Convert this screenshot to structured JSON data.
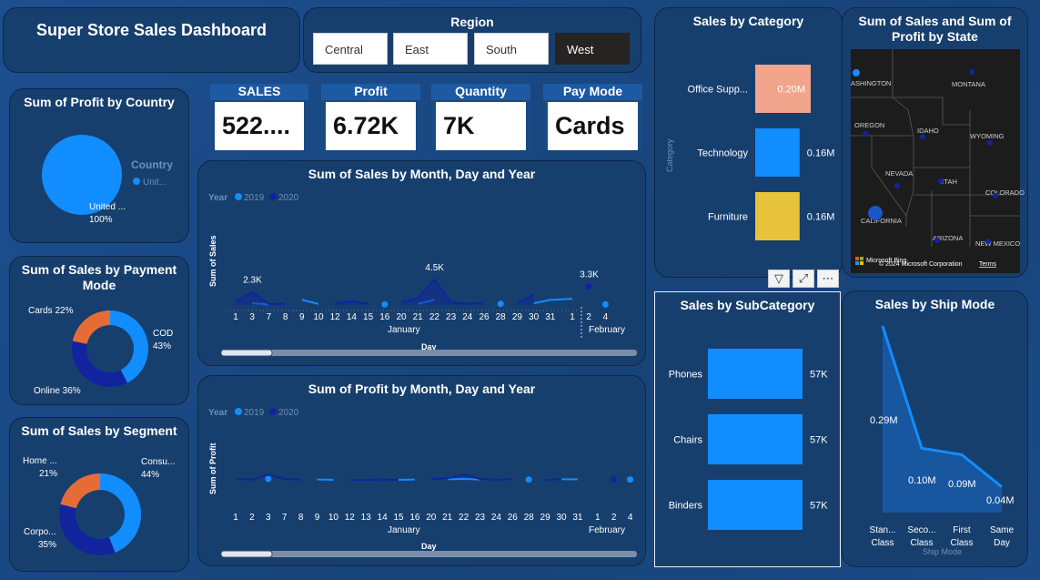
{
  "title": "Super Store Sales Dashboard",
  "region": {
    "title": "Region",
    "options": [
      "Central",
      "East",
      "South",
      "West"
    ],
    "selected": "West"
  },
  "kpis": [
    {
      "label": "SALES",
      "value": "522...."
    },
    {
      "label": "Profit",
      "value": "6.72K"
    },
    {
      "label": "Quantity",
      "value": "7K"
    },
    {
      "label": "Pay Mode",
      "value": "Cards"
    }
  ],
  "colors": {
    "primary": "#118dff",
    "dark_series": "#12239e",
    "orange": "#e66c37",
    "office_supplies": "#f0a58c",
    "furniture": "#e6c33a"
  },
  "profit_country": {
    "title": "Sum of Profit by Country",
    "legend_title": "Country",
    "legend_item": "Unit...",
    "label_name": "United ...",
    "label_pct": "100%"
  },
  "sales_line": {
    "title": "Sum of Sales by Month, Day and Year",
    "legend_title": "Year",
    "years": [
      "2019",
      "2020"
    ],
    "ylabel": "Sum of Sales",
    "xlabel": "Day",
    "month_jan": "January",
    "month_feb": "February",
    "labels": [
      "2.3K",
      "4.5K",
      "3.3K"
    ]
  },
  "profit_line": {
    "title": "Sum of Profit by Month, Day and Year",
    "legend_title": "Year",
    "years": [
      "2019",
      "2020"
    ],
    "ylabel": "Sum of Profit",
    "xlabel": "Day",
    "month_jan": "January",
    "month_feb": "February"
  },
  "payment": {
    "title": "Sum of Sales by Payment Mode",
    "labels": {
      "cards": "Cards 22%",
      "cod_name": "COD",
      "cod_pct": "43%",
      "online": "Online 36%"
    }
  },
  "segment": {
    "title": "Sum of Sales by Segment",
    "labels": {
      "home_name": "Home ...",
      "home_pct": "21%",
      "consumer_name": "Consu...",
      "consumer_pct": "44%",
      "corporate_name": "Corpo...",
      "corporate_pct": "35%"
    }
  },
  "category": {
    "title": "Sales by Category",
    "axis_label": "Category",
    "names": [
      "Office Supp...",
      "Technology",
      "Furniture"
    ],
    "value_labels": [
      "0.20M",
      "0.16M",
      "0.16M"
    ]
  },
  "state_map": {
    "title": "Sum of Sales and Sum of Profit by State",
    "states": [
      "ASHINGTON",
      "MONTANA",
      "OREGON",
      "IDAHO",
      "WYOMING",
      "NEVADA",
      "UTAH",
      "COLORADO",
      "CALIFORNIA",
      "ARIZONA",
      "NEW MEXICO"
    ],
    "brand": "Microsoft Bing",
    "copyright": "© 2024 Microsoft Corporation",
    "terms": "Terms"
  },
  "subcategory": {
    "title": "Sales by SubCategory",
    "names": [
      "Phones",
      "Chairs",
      "Binders"
    ],
    "value_labels": [
      "57K",
      "57K",
      "57K"
    ]
  },
  "ship_mode": {
    "title": "Sales by Ship Mode",
    "xlabel": "Ship Mode",
    "category_line1": [
      "Stan...",
      "Seco...",
      "First",
      "Same"
    ],
    "category_line2": [
      "Class",
      "Class",
      "Class",
      "Day"
    ],
    "value_labels": [
      "0.29M",
      "0.10M",
      "0.09M",
      "0.04M"
    ]
  },
  "chart_data": [
    {
      "type": "pie",
      "title": "Sum of Profit by Country",
      "categories": [
        "United States"
      ],
      "values": [
        100
      ]
    },
    {
      "type": "line",
      "title": "Sum of Sales by Month, Day and Year",
      "xlabel": "Day",
      "ylabel": "Sum of Sales",
      "x": [
        "1",
        "3",
        "7",
        "8",
        "9",
        "10",
        "12",
        "14",
        "15",
        "16",
        "20",
        "21",
        "22",
        "23",
        "24",
        "26",
        "28",
        "29",
        "30",
        "31",
        "1",
        "2",
        "4"
      ],
      "x_months": [
        "January",
        "January",
        "January",
        "January",
        "January",
        "January",
        "January",
        "January",
        "January",
        "January",
        "January",
        "January",
        "January",
        "January",
        "January",
        "January",
        "January",
        "January",
        "January",
        "January",
        "February",
        "February",
        "February"
      ],
      "series": [
        {
          "name": "2019",
          "values": [
            null,
            0.3,
            0.1,
            null,
            0.9,
            0.2,
            null,
            null,
            null,
            0.1,
            null,
            0.2,
            0.9,
            null,
            null,
            null,
            0.2,
            null,
            0.3,
            0.9,
            1.1,
            null,
            0.1
          ]
        },
        {
          "name": "2020",
          "values": [
            0.6,
            2.3,
            0.2,
            0.2,
            null,
            null,
            0.3,
            0.7,
            0.2,
            null,
            0.5,
            1.2,
            4.5,
            0.5,
            0.2,
            0.5,
            null,
            0.3,
            1.8,
            null,
            null,
            3.3,
            null
          ]
        }
      ],
      "data_labels": [
        "2.3K",
        "4.5K",
        "3.3K"
      ]
    },
    {
      "type": "line",
      "title": "Sum of Profit by Month, Day and Year",
      "xlabel": "Day",
      "ylabel": "Sum of Profit",
      "x": [
        "1",
        "2",
        "3",
        "7",
        "8",
        "9",
        "10",
        "12",
        "13",
        "14",
        "15",
        "16",
        "20",
        "21",
        "22",
        "23",
        "24",
        "26",
        "28",
        "29",
        "30",
        "31",
        "1",
        "2",
        "4"
      ],
      "x_months": [
        "January",
        "January",
        "January",
        "January",
        "January",
        "January",
        "January",
        "January",
        "January",
        "January",
        "January",
        "January",
        "January",
        "January",
        "January",
        "January",
        "January",
        "January",
        "January",
        "January",
        "January",
        "January",
        "February",
        "February",
        "February"
      ],
      "series": [
        {
          "name": "2019",
          "values": [
            null,
            null,
            0.05,
            null,
            null,
            0.02,
            0.0,
            null,
            null,
            null,
            0.0,
            0.02,
            null,
            0.03,
            0.05,
            0.02,
            null,
            null,
            0.02,
            null,
            0.03,
            0.03,
            null,
            null,
            0.02
          ]
        },
        {
          "name": "2020",
          "values": [
            0.05,
            0.0,
            0.3,
            0.05,
            0.0,
            null,
            null,
            0.0,
            0.0,
            0.02,
            0.0,
            null,
            0.05,
            0.08,
            0.3,
            0.05,
            0.0,
            0.05,
            null,
            0.0,
            0.03,
            null,
            null,
            0.02,
            null
          ]
        }
      ]
    },
    {
      "type": "pie",
      "title": "Sum of Sales by Payment Mode",
      "categories": [
        "COD",
        "Online",
        "Cards"
      ],
      "values": [
        43,
        36,
        22
      ]
    },
    {
      "type": "pie",
      "title": "Sum of Sales by Segment",
      "categories": [
        "Consumer",
        "Corporate",
        "Home Office"
      ],
      "values": [
        44,
        35,
        21
      ]
    },
    {
      "type": "bar",
      "title": "Sales by Category",
      "categories": [
        "Office Supplies",
        "Technology",
        "Furniture"
      ],
      "values": [
        0.2,
        0.16,
        0.16
      ],
      "unit": "M"
    },
    {
      "type": "bar",
      "title": "Sales by SubCategory",
      "categories": [
        "Phones",
        "Chairs",
        "Binders"
      ],
      "values": [
        57,
        57,
        57
      ],
      "unit": "K"
    },
    {
      "type": "area",
      "title": "Sales by Ship Mode",
      "xlabel": "Ship Mode",
      "categories": [
        "Standard Class",
        "Second Class",
        "First Class",
        "Same Day"
      ],
      "values": [
        0.29,
        0.1,
        0.09,
        0.04
      ],
      "unit": "M"
    }
  ]
}
